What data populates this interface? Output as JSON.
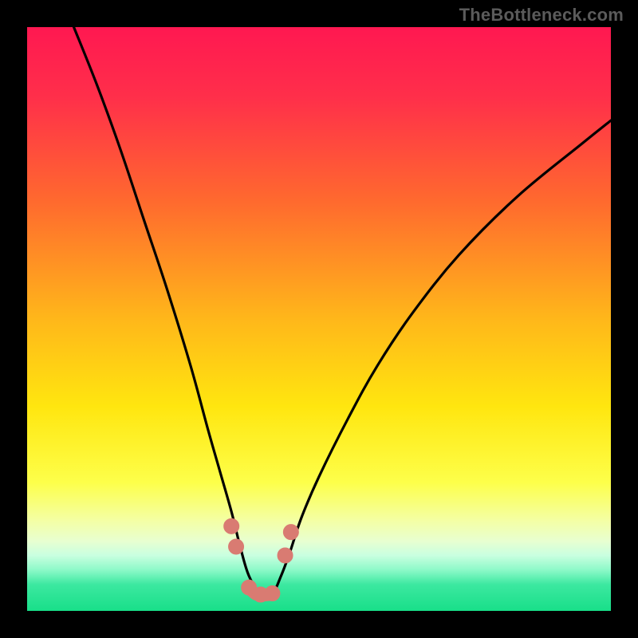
{
  "watermark": "TheBottleneck.com",
  "colors": {
    "black": "#000000",
    "curve": "#000000",
    "marker_fill": "#d97b72",
    "marker_stroke": "#d97b72",
    "gradient_stops": [
      {
        "offset": 0.0,
        "color": "#ff1851"
      },
      {
        "offset": 0.12,
        "color": "#ff2f4a"
      },
      {
        "offset": 0.3,
        "color": "#ff6a2e"
      },
      {
        "offset": 0.5,
        "color": "#ffb71a"
      },
      {
        "offset": 0.65,
        "color": "#ffe60f"
      },
      {
        "offset": 0.78,
        "color": "#fdff4a"
      },
      {
        "offset": 0.845,
        "color": "#f4ffa4"
      },
      {
        "offset": 0.88,
        "color": "#e8ffd0"
      },
      {
        "offset": 0.905,
        "color": "#c9ffe0"
      },
      {
        "offset": 0.93,
        "color": "#8cf9c8"
      },
      {
        "offset": 0.955,
        "color": "#3ce8a0"
      },
      {
        "offset": 1.0,
        "color": "#18df89"
      }
    ]
  },
  "chart_data": {
    "type": "line",
    "title": "",
    "xlabel": "",
    "ylabel": "",
    "x_range": [
      0,
      100
    ],
    "y_range": [
      0,
      100
    ],
    "note": "Bottleneck-style V-curve. y≈100 is top (red), y≈0 is bottom (green). Minimum around x≈38-43.",
    "series": [
      {
        "name": "bottleneck-curve",
        "x": [
          8,
          12,
          16,
          20,
          24,
          28,
          31,
          33,
          35,
          36.5,
          38,
          40,
          42,
          43.5,
          45,
          47,
          50,
          55,
          60,
          66,
          74,
          84,
          95,
          100
        ],
        "y": [
          100,
          90,
          79,
          67,
          55,
          42,
          31,
          24,
          17,
          11,
          6,
          3,
          3,
          6,
          10,
          16,
          23,
          33,
          42,
          51,
          61,
          71,
          80,
          84
        ]
      }
    ],
    "markers": {
      "name": "highlighted-points",
      "x": [
        35.0,
        35.8,
        38.0,
        40.0,
        42.0,
        44.2,
        45.2
      ],
      "y": [
        14.5,
        11.0,
        4.0,
        2.8,
        3.0,
        9.5,
        13.5
      ]
    },
    "bottom_connector": {
      "x": [
        38.0,
        40.0,
        42.0
      ],
      "y": [
        4.0,
        2.8,
        3.0
      ]
    }
  }
}
